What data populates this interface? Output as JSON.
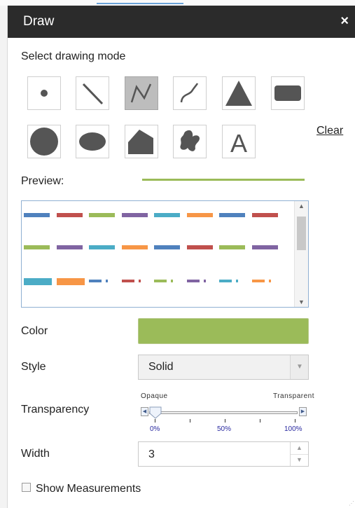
{
  "dialog": {
    "title": "Draw",
    "close_label": "×"
  },
  "drawing_mode": {
    "label": "Select drawing mode",
    "selected": "polyline",
    "modes": [
      "point",
      "line",
      "polyline",
      "freehand-polyline",
      "triangle",
      "rectangle",
      "circle",
      "ellipse",
      "polygon",
      "freehand-polygon",
      "text"
    ],
    "text_mode_glyph": "A",
    "clear_label": "Clear"
  },
  "preview": {
    "label": "Preview:",
    "line_color": "#9bbb59"
  },
  "line_styles": {
    "rows": [
      [
        "#4f81bd",
        "#c0504d",
        "#9bbb59",
        "#8064a2",
        "#4bacc6",
        "#f79646",
        "#4f81bd",
        "#c0504d"
      ],
      [
        "#9bbb59",
        "#8064a2",
        "#4bacc6",
        "#f79646",
        "#4f81bd",
        "#c0504d",
        "#9bbb59",
        "#8064a2"
      ],
      [
        "#4bacc6",
        "#f79646",
        "#4f81bd",
        "#c0504d",
        "#9bbb59",
        "#8064a2",
        "#4bacc6",
        "#f79646"
      ]
    ]
  },
  "color": {
    "label": "Color",
    "value": "#9bbb59"
  },
  "style": {
    "label": "Style",
    "value": "Solid"
  },
  "transparency": {
    "label": "Transparency",
    "left_label": "Opaque",
    "right_label": "Transparent",
    "ticks": [
      "0%",
      "50%",
      "100%"
    ],
    "value_percent": 0
  },
  "width": {
    "label": "Width",
    "value": "3"
  },
  "measurements": {
    "label": "Show Measurements",
    "checked": false
  }
}
